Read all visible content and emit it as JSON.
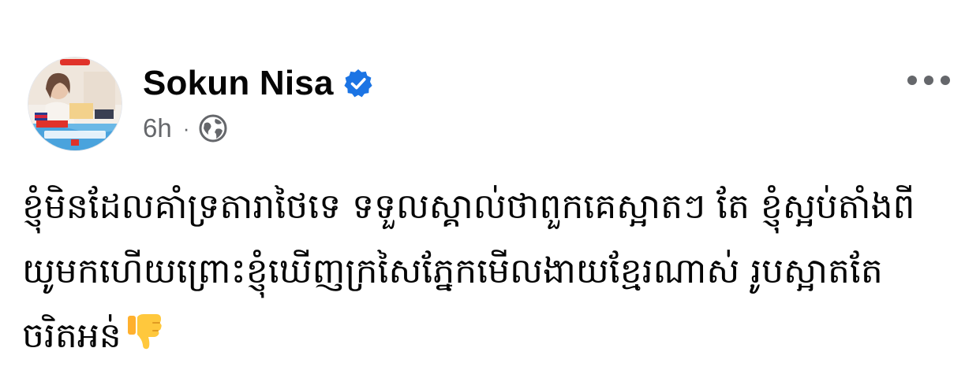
{
  "post": {
    "author": {
      "name": "Sokun Nisa",
      "verified": true,
      "avatar_icon": "profile-photo"
    },
    "meta": {
      "time": "6h",
      "separator": "·",
      "audience_icon": "globe-icon"
    },
    "menu_icon": "more-options-icon",
    "text_lines": [
      "ខ្ញុំមិនដែលគាំទ្រតារាថៃទេ ទទួលស្គាល់ថាពួកគេស្អាតៗ តែ ខ្ញុំស្អប់តាំងពី",
      "យូមកហើយព្រោះខ្ញុំឃើញក្រសៃភ្នែកមើលងាយខ្មែរណាស់ រូបស្អាតតែ",
      "ចរិតអន់"
    ],
    "emoji": "thumbs-down-emoji"
  },
  "colors": {
    "text": "#050505",
    "secondary": "#65676b",
    "verified_blue": "#1b74e4",
    "emoji_yellow": "#ffc83d"
  }
}
